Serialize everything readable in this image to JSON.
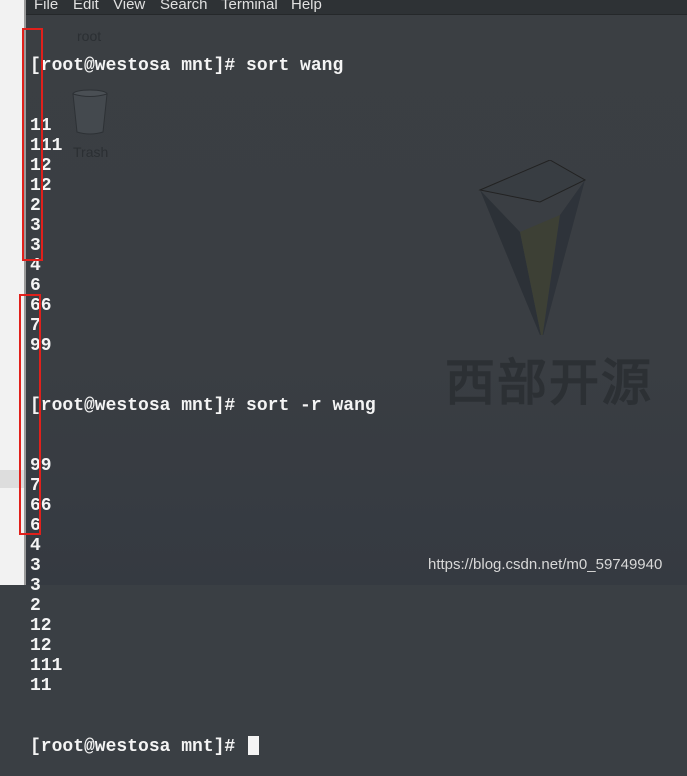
{
  "menu": [
    "File",
    "Edit",
    "View",
    "Search",
    "Terminal",
    "Help"
  ],
  "desktop": {
    "home_label": "root",
    "trash_label": "Trash"
  },
  "logo_text": "西部开源",
  "terminal": {
    "prompt": "[root@westosa mnt]# ",
    "commands": [
      "sort wang",
      "sort -r wang",
      ""
    ],
    "output_sort": [
      "11",
      "111",
      "12",
      "12",
      "2",
      "3",
      "3",
      "4",
      "6",
      "66",
      "7",
      "99"
    ],
    "output_sort_r": [
      "99",
      "7",
      "66",
      "6",
      "4",
      "3",
      "3",
      "2",
      "12",
      "12",
      "111",
      "11"
    ]
  },
  "annotation_color": "#e0201b",
  "watermark": "https://blog.csdn.net/m0_59749940"
}
